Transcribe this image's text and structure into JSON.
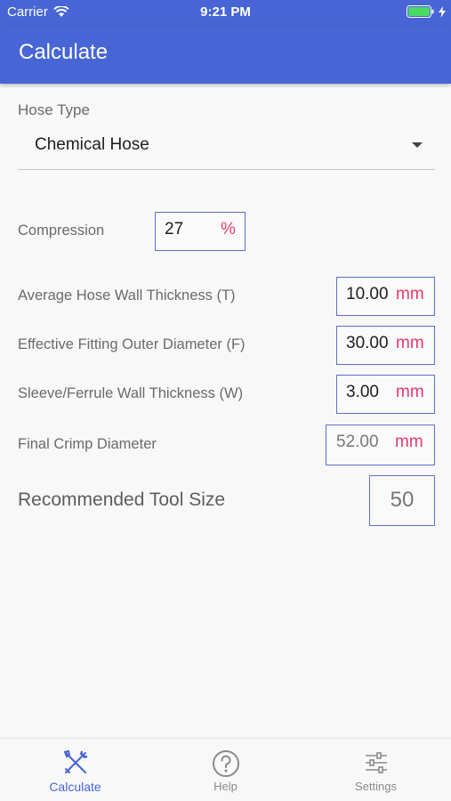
{
  "status": {
    "carrier": "Carrier",
    "time": "9:21 PM",
    "battery_color": "#4cd964"
  },
  "appbar": {
    "title": "Calculate",
    "color": "#4765d5"
  },
  "hose_type": {
    "label": "Hose Type",
    "value": "Chemical Hose"
  },
  "compression": {
    "label": "Compression",
    "value": "27",
    "unit": "%"
  },
  "fields": [
    {
      "label": "Average Hose Wall Thickness (T)",
      "value": "10.00",
      "unit": "mm"
    },
    {
      "label": "Effective Fitting Outer Diameter (F)",
      "value": "30.00",
      "unit": "mm"
    },
    {
      "label": "Sleeve/Ferrule Wall Thickness (W)",
      "value": "3.00",
      "unit": "mm"
    },
    {
      "label": "Final Crimp Diameter",
      "value": "52.00",
      "unit": "mm"
    }
  ],
  "result": {
    "label": "Recommended Tool Size",
    "value": "50"
  },
  "tabs": [
    {
      "label": "Calculate",
      "icon": "tools-icon",
      "active": true
    },
    {
      "label": "Help",
      "icon": "help-circle-icon",
      "active": false
    },
    {
      "label": "Settings",
      "icon": "sliders-icon",
      "active": false
    }
  ],
  "colors": {
    "accent": "#4765d5",
    "unit": "#e53a6b",
    "border": "#5b70c9"
  }
}
